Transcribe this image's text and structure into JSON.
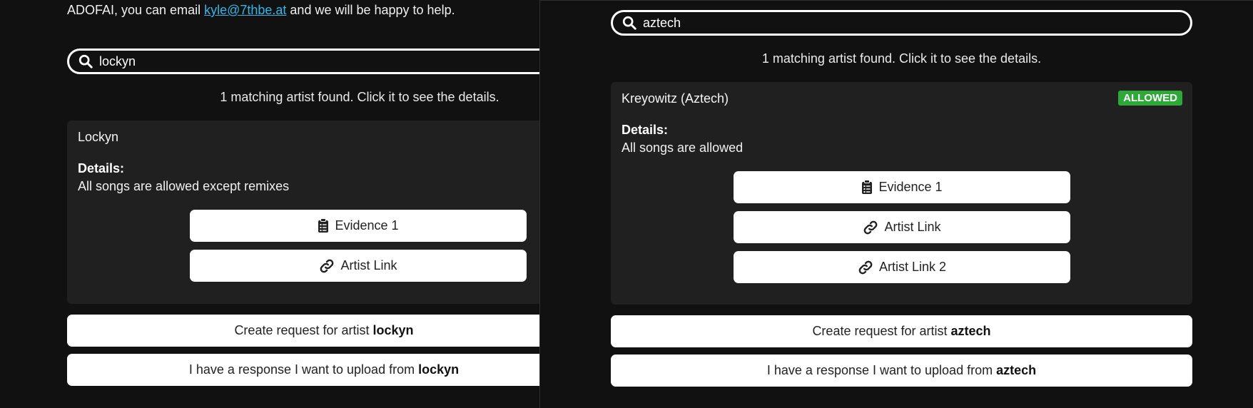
{
  "left": {
    "intro": {
      "prefix": "ADOFAI, you can email ",
      "email": "kyle@7thbe.at",
      "suffix": " and we will be happy to help."
    },
    "search": {
      "value": "lockyn",
      "icon": "search-icon"
    },
    "result_count": "1 matching artist found. Click it to see the details.",
    "card": {
      "artist_name": "Lockyn",
      "details_label": "Details:",
      "details_text": "All songs are allowed except remixes",
      "links": [
        {
          "label": "Evidence 1",
          "icon": "clipboard-icon"
        },
        {
          "label": "Artist Link",
          "icon": "link-icon"
        }
      ]
    },
    "create_request": {
      "prefix": "Create request for artist",
      "artist": "lockyn"
    },
    "upload_response": {
      "prefix": "I have a response I want to upload from",
      "artist": "lockyn"
    }
  },
  "right": {
    "search": {
      "value": "aztech",
      "icon": "search-icon"
    },
    "result_count": "1 matching artist found. Click it to see the details.",
    "card": {
      "artist_name": "Kreyowitz (Aztech)",
      "status_badge": "ALLOWED",
      "status_color": "#2fa83a",
      "details_label": "Details:",
      "details_text": "All songs are allowed",
      "links": [
        {
          "label": "Evidence 1",
          "icon": "clipboard-icon"
        },
        {
          "label": "Artist Link",
          "icon": "link-icon"
        },
        {
          "label": "Artist Link 2",
          "icon": "link-icon"
        }
      ]
    },
    "create_request": {
      "prefix": "Create request for artist",
      "artist": "aztech"
    },
    "upload_response": {
      "prefix": "I have a response I want to upload from",
      "artist": "aztech"
    }
  },
  "colors": {
    "background": "#111112",
    "card": "#202021",
    "link": "#35b6e6",
    "allowed_badge": "#2fa83a"
  }
}
